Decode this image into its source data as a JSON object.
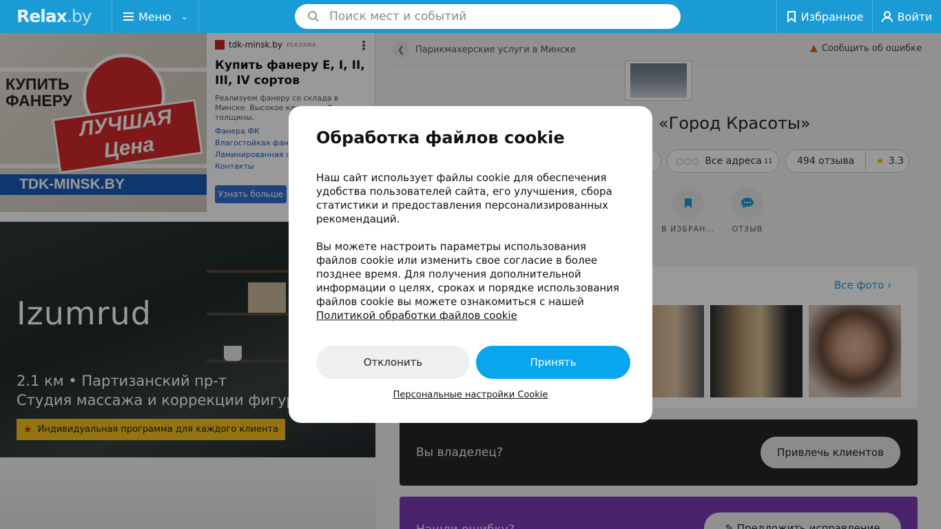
{
  "header": {
    "logo_main": "Relax",
    "logo_suffix": ".by",
    "menu_label": "Меню",
    "search_placeholder": "Поиск мест и событий",
    "favorites_label": "Избранное",
    "login_label": "Войти",
    "bg_color": "#1a9bd6"
  },
  "ad": {
    "image_text_1": "КУПИТЬ",
    "image_text_2": "ФАНЕРУ",
    "image_banner_1": "ЛУЧШАЯ",
    "image_banner_2": "Цена",
    "image_brand": "TDK-MINSK.BY",
    "source": "tdk-minsk.by",
    "tag": "РЕКЛАМА",
    "title": "Купить фанеру Е, I, II, III, IV сортов",
    "description": "Реализуем фанеру со склада в Минске. Высокое качество. Ф... и толщины.",
    "links": [
      "Фанера ФК",
      "Влагостойкая фане...",
      "Ламинированная ф...",
      "Контакты"
    ],
    "button_label": "Узнать больше"
  },
  "promo": {
    "name": "Izumrud",
    "address": "2.1 км • Партизанский пр-т",
    "category": "Студия массажа и коррекции фигуры",
    "badge": "Индивидуальная программа для каждого клиента"
  },
  "page": {
    "breadcrumb": "Парикмахерские услуги в Минске",
    "report_label": "Сообщить об ошибке",
    "title": "«Город Красоты»",
    "all_addresses": "Все адреса",
    "addresses_count": "11",
    "reviews": "494 отзыва",
    "rating": "3.3",
    "actions": [
      {
        "label": "В ИЗБРАН..."
      },
      {
        "label": "ОТЗЫВ"
      }
    ],
    "all_photos": "Все фото",
    "owner_question": "Вы владелец?",
    "owner_button": "Привлечь клиентов",
    "error_question": "Нашли ошибку?",
    "error_button": "Предложить исправление"
  },
  "cookie": {
    "title": "Обработка файлов cookie",
    "paragraph_1": "Наш сайт использует файлы cookie для обеспечения удобства пользователей сайта, его улучшения, сбора статистики и предоставления персонализированных рекомендаций.",
    "paragraph_2": "Вы можете настроить параметры использования файлов cookie или изменить свое согласие в более позднее время. Для получения дополнительной информации о целях, сроках и порядке использования файлов cookie вы можете ознакомиться с нашей",
    "policy_link": "Политикой обработки файлов cookie",
    "decline_label": "Отклонить",
    "accept_label": "Принять",
    "settings_link": "Персональные настройки Cookie",
    "accept_color": "#07a6ee"
  }
}
